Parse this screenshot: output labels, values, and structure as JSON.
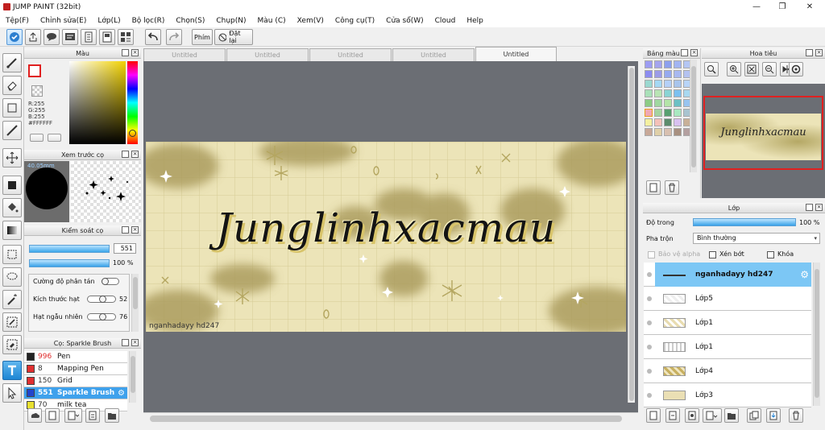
{
  "window": {
    "title": "JUMP PAINT (32bit)",
    "controls": [
      "minimize",
      "restore",
      "close"
    ]
  },
  "menu": [
    "Tệp(F)",
    "Chỉnh sửa(E)",
    "Lớp(L)",
    "Bộ lọc(R)",
    "Chọn(S)",
    "Chụp(N)",
    "Màu (C)",
    "Xem(V)",
    "Công cụ(T)",
    "Cửa sổ(W)",
    "Cloud",
    "Help"
  ],
  "toolbar": {
    "keys_label": "Phím",
    "reset_label": "Đặt lại"
  },
  "doc_tabs": [
    "Untitled",
    "Untitled",
    "Untitled",
    "Untitled",
    "Untitled"
  ],
  "color_panel": {
    "title": "Màu",
    "r": "R:255",
    "g": "G:255",
    "b": "B:255",
    "hex": "#FFFFFF",
    "primary_color": "#ffffff",
    "primary_border": "#e02020"
  },
  "brush_preview": {
    "title": "Xem trước cọ",
    "size": "40.05mm"
  },
  "brush_control": {
    "title": "Kiểm soát cọ",
    "size_value": "551",
    "opacity_value": "100 %",
    "opacity_fraction": 1.0,
    "params": [
      {
        "label": "Cường độ phân tán",
        "value": ""
      },
      {
        "label": "Kích thước hạt",
        "value": "52"
      },
      {
        "label": "Hạt ngẫu nhiên",
        "value": "76"
      }
    ]
  },
  "brush_list": {
    "title": "Cọ: Sparkle Brush",
    "items": [
      {
        "size": "996",
        "name": "Pen",
        "color": "#222222",
        "size_red": true,
        "selected": false
      },
      {
        "size": "8",
        "name": "Mapping Pen",
        "color": "#e03030",
        "size_red": false,
        "selected": false
      },
      {
        "size": "150",
        "name": "Grid",
        "color": "#e03030",
        "size_red": false,
        "selected": false
      },
      {
        "size": "551",
        "name": "Sparkle Brush",
        "color": "#2244cc",
        "size_red": false,
        "selected": true
      },
      {
        "size": "70",
        "name": "milk tea",
        "color": "#e8e030",
        "size_red": false,
        "selected": false
      }
    ]
  },
  "canvas": {
    "art_text": "Junglinhxacmau",
    "watermark": "nganhadayy hd247",
    "bg_color": "#ece4b8",
    "stain_color": "#a8995a"
  },
  "swatch_panel": {
    "title": "Bảng màu",
    "colors": [
      "#9c9cf2",
      "#a4a4ee",
      "#8ca0ee",
      "#a2b4f2",
      "#b4c6f4",
      "#8c8cf0",
      "#9c9ce8",
      "#96aaf0",
      "#a8b8f0",
      "#b4c2f0",
      "#9ad8d0",
      "#a4d8f4",
      "#b4d0f8",
      "#a8c4ec",
      "#b8d4f8",
      "#a8e0b8",
      "#b8e4b4",
      "#8ad4d4",
      "#7cc0f0",
      "#a8d8f0",
      "#8ccc84",
      "#a0d8a0",
      "#b4e4a8",
      "#6cc0c4",
      "#98c4f0",
      "#f0a8b4",
      "#a4d4a0",
      "#58a070",
      "#a8e8c0",
      "#a8c4d0",
      "#f4f0a0",
      "#f4c0b8",
      "#5c8c6c",
      "#d8c0f0",
      "#c8b098",
      "#c8a898",
      "#e0d0a8",
      "#d8c0b0",
      "#a89080",
      "#b4a0a0"
    ]
  },
  "navigator": {
    "title": "Hoa tiêu"
  },
  "layer_panel": {
    "title": "Lớp",
    "opacity_label": "Độ trong",
    "opacity_value": "100 %",
    "opacity_fraction": 1.0,
    "blend_label": "Pha trộn",
    "blend_value": "Bình thường",
    "protect_alpha": "Bảo vệ alpha",
    "clip": "Xén bớt",
    "lock": "Khóa",
    "layers": [
      {
        "name": "nganhadayy hd247",
        "selected": true
      },
      {
        "name": "Lớp5",
        "selected": false
      },
      {
        "name": "Lớp1",
        "selected": false
      },
      {
        "name": "Lớp1",
        "selected": false
      },
      {
        "name": "Lớp4",
        "selected": false
      },
      {
        "name": "Lớp3",
        "selected": false
      }
    ]
  }
}
